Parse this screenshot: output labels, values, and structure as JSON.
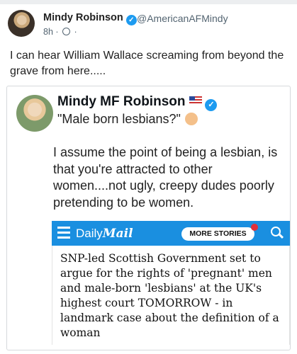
{
  "post": {
    "author_name": "Mindy Robinson",
    "handle": "@AmericanAFMindy",
    "time": "8h",
    "text": "I can hear William Wallace screaming from beyond the grave from here....."
  },
  "quoted_post": {
    "author_name": "Mindy MF Robinson",
    "quote_line": "\"Male born lesbians?\"",
    "body": "I assume the point of being a lesbian, is that you're attracted to other women....not ugly, creepy dudes poorly pretending to be women."
  },
  "dailymail": {
    "logo_light": "Daily",
    "logo_bold": "Mail",
    "more_stories_label": "MORE STORIES",
    "headline": "SNP-led Scottish Government set to argue for the rights of 'pregnant' men and male-born 'lesbians' at the UK's highest court TOMORROW - in landmark case about the definition of a woman",
    "bar_color": "#1a8fe0"
  },
  "colors": {
    "verified": "#1d9bf0",
    "text": "#0f1419",
    "muted": "#536471"
  }
}
